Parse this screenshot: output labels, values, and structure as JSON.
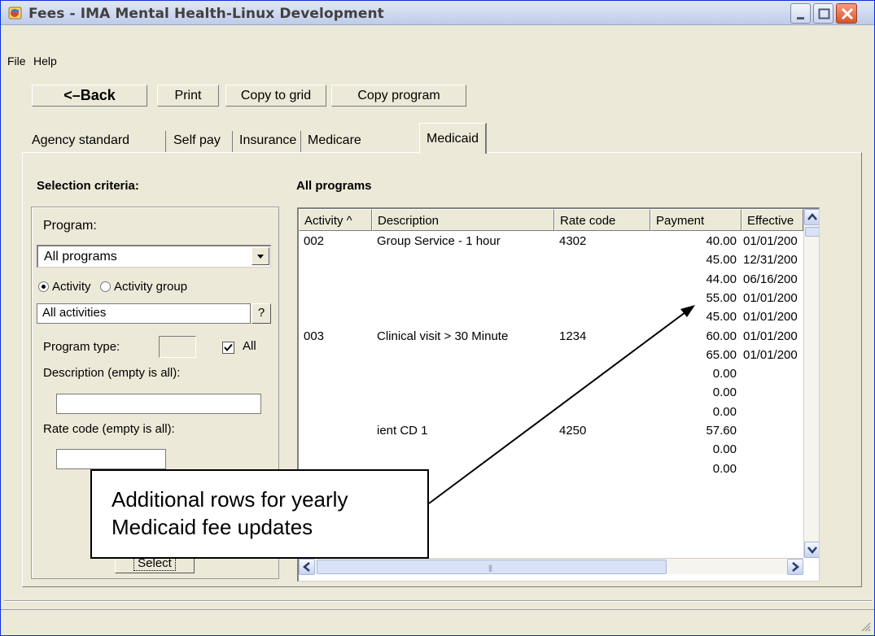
{
  "window": {
    "title": "Fees - IMA Mental Health-Linux Development",
    "colors": {
      "frame": "#ece9d8",
      "titlebar": "#d3ddf2",
      "close": "#d8542a"
    }
  },
  "menu": {
    "file": "File",
    "help": "Help"
  },
  "toolbar": {
    "back_label": "<–Back",
    "print_label": "Print",
    "copy_grid_label": "Copy to grid",
    "copy_program_label": "Copy program"
  },
  "tabs": [
    {
      "label": "Agency standard"
    },
    {
      "label": "Self pay"
    },
    {
      "label": "Insurance"
    },
    {
      "label": "Medicare"
    },
    {
      "label": "Medicaid",
      "selected": true
    }
  ],
  "criteria": {
    "heading": "Selection criteria:",
    "program_label": "Program:",
    "program_value": "All programs",
    "radio_activity": "Activity",
    "radio_activity_group": "Activity group",
    "activities_value": "All activities",
    "lookup_label": "?",
    "program_type_label": "Program type:",
    "all_label": "All",
    "all_checked": true,
    "description_label": "Description (empty is all):",
    "rate_code_label": "Rate code (empty is all):",
    "select_button": "Select"
  },
  "grid": {
    "heading": "All programs",
    "columns": [
      "Activity ^",
      "Description",
      "Rate code",
      "Payment",
      "Effective"
    ],
    "rows": [
      {
        "activity": "002",
        "description": "Group Service - 1 hour",
        "rate_code": "4302",
        "payment": "40.00",
        "effective": "01/01/200"
      },
      {
        "activity": "",
        "description": "",
        "rate_code": "",
        "payment": "45.00",
        "effective": "12/31/200"
      },
      {
        "activity": "",
        "description": "",
        "rate_code": "",
        "payment": "44.00",
        "effective": "06/16/200"
      },
      {
        "activity": "",
        "description": "",
        "rate_code": "",
        "payment": "55.00",
        "effective": "01/01/200"
      },
      {
        "activity": "",
        "description": "",
        "rate_code": "",
        "payment": "45.00",
        "effective": "01/01/200"
      },
      {
        "activity": "003",
        "description": "Clinical visit > 30 Minute",
        "rate_code": "1234",
        "payment": "60.00",
        "effective": "01/01/200"
      },
      {
        "activity": "",
        "description": "",
        "rate_code": "",
        "payment": "65.00",
        "effective": "01/01/200"
      },
      {
        "activity": "",
        "description": "",
        "rate_code": "",
        "payment": "0.00",
        "effective": ""
      },
      {
        "activity": "",
        "description": "",
        "rate_code": "",
        "payment": "0.00",
        "effective": ""
      },
      {
        "activity": "",
        "description": "",
        "rate_code": "",
        "payment": "0.00",
        "effective": ""
      },
      {
        "activity": "",
        "description": "ient CD 1",
        "rate_code": "4250",
        "payment": "57.60",
        "effective": ""
      },
      {
        "activity": "",
        "description": "",
        "rate_code": "",
        "payment": "0.00",
        "effective": ""
      },
      {
        "activity": "",
        "description": "",
        "rate_code": "",
        "payment": "0.00",
        "effective": ""
      }
    ]
  },
  "callout": {
    "line1": "Additional rows for yearly",
    "line2": "Medicaid fee updates"
  }
}
